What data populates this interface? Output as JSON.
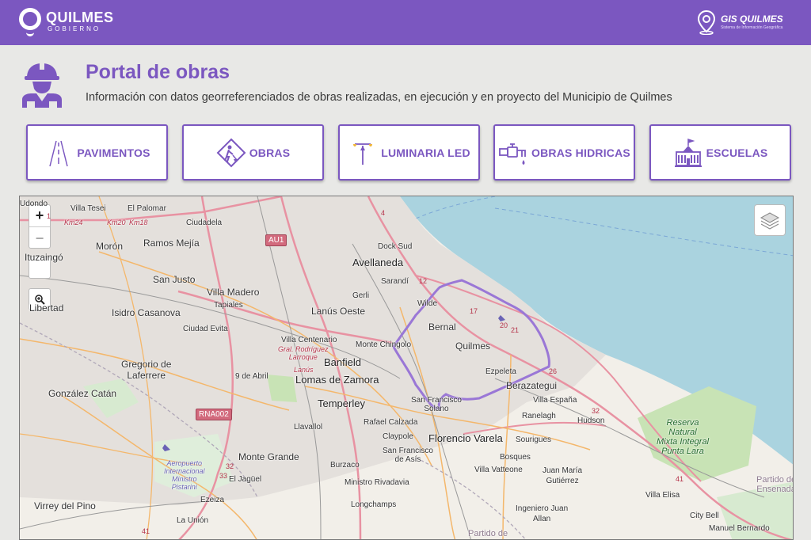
{
  "header": {
    "logo_name": "QUILMES",
    "logo_sub": "GOBIERNO",
    "gis_name": "GIS QUILMES",
    "gis_sub": "Sistema de Información Geográfica"
  },
  "intro": {
    "title": "Portal de obras",
    "subtitle": "Información con datos georreferenciados de obras realizadas, en ejecución y en proyecto del Municipio de Quilmes"
  },
  "categories": [
    {
      "label": "PAVIMENTOS",
      "icon": "road-icon"
    },
    {
      "label": "OBRAS",
      "icon": "construction-worker-icon"
    },
    {
      "label": "LUMINARIA LED",
      "icon": "street-lamp-icon"
    },
    {
      "label": "OBRAS HIDRICAS",
      "icon": "water-tap-icon"
    },
    {
      "label": "ESCUELAS",
      "icon": "school-building-icon"
    }
  ],
  "map": {
    "zoom_in": "+",
    "zoom_out": "−",
    "labels": {
      "villa_tesei": "Villa Tesei",
      "el_palomar": "El Palomar",
      "ciudadela": "Ciudadela",
      "ramos_mejia": "Ramos Mejía",
      "moron": "Morón",
      "ituzaingo": "Ituzaingó",
      "san_justo": "San Justo",
      "villa_madero": "Villa Madero",
      "tapiales": "Tapiales",
      "isidro_casanova": "Isidro Casanova",
      "libertad": "Libertad",
      "ciudad_evita": "Ciudad Evita",
      "gregorio": "Gregorio de\nLaferrere",
      "gonzalez_catan": "González Catán",
      "nueve_de_abril": "9 de Abril",
      "lomas": "Lomas de Zamora",
      "banfield": "Banfield",
      "lanus_oeste": "Lanús Oeste",
      "avellaneda": "Avellaneda",
      "dock_sud": "Dock Sud",
      "sarandi": "Sarandí",
      "gerli": "Gerli",
      "wilde": "Wilde",
      "bernal": "Bernal",
      "quilmes": "Quilmes",
      "monte_chingolo": "Monte Chingolo",
      "villa_centenario": "Villa Centenario",
      "gral_rodriguez": "Gral. Rodríguez\nLarroque",
      "lanus": "Lanús",
      "lanus2": "Lanús",
      "lanus3": "Lanús",
      "temperley": "Temperley",
      "llavallol": "Llavallol",
      "rafael_calzada": "Rafael Calzada",
      "claypole": "Claypole",
      "florencio_varela": "Florencio Varela",
      "san_francisco_solano": "San Francisco\nSolano",
      "san_francisco_asis": "San Francisco\nde Asís",
      "ezpeleta": "Ezpeleta",
      "berazategui": "Berazategui",
      "villa_espana": "Villa España",
      "ranelagh": "Ranelagh",
      "hudson": "Hudson",
      "sourigues": "Sourigues",
      "bosques": "Bosques",
      "villa_vatteone": "Villa Vatteone",
      "juan_maria_gutierrez": "Juan María\nGutiérrez",
      "monte_grande": "Monte Grande",
      "el_jaguel": "El Jagüel",
      "burzaco": "Burzaco",
      "ministro_rivadavia": "Ministro Rivadavia",
      "longchamps": "Longchamps",
      "ezeiza": "Ezeiza",
      "la_union": "La Unión",
      "virrey_del_pino": "Virrey del Pino",
      "aeropuerto": "Aeropuerto\nInternacional\nMinistro\nPistarini",
      "reserva": "Reserva\nNatural\nMixta Integral\nPunta Lara",
      "villa_elisa": "Villa Elisa",
      "city_bell": "City Bell",
      "manuel_bernardo": "Manuel Bernardo",
      "ingeniero_juan_allan": "Ingeniero Juan\nAllan",
      "partido_de": "Partido de",
      "partido_ensenada": "Partido de\nEnsenada",
      "lanus_base": "Lanús",
      "villa_udondo": "Udondo",
      "km24": "Km24",
      "km20": "Km20",
      "km18": "Km18"
    },
    "shields": [
      "AU1",
      "RNA002"
    ],
    "route_numbers": [
      "4",
      "12",
      "17",
      "20",
      "21",
      "26",
      "32",
      "32",
      "33",
      "41",
      "41",
      "1"
    ]
  },
  "colors": {
    "brand": "#7b57c0",
    "water": "#aad3df",
    "park": "#c8e3b5",
    "boundary": "#9a77d6"
  }
}
